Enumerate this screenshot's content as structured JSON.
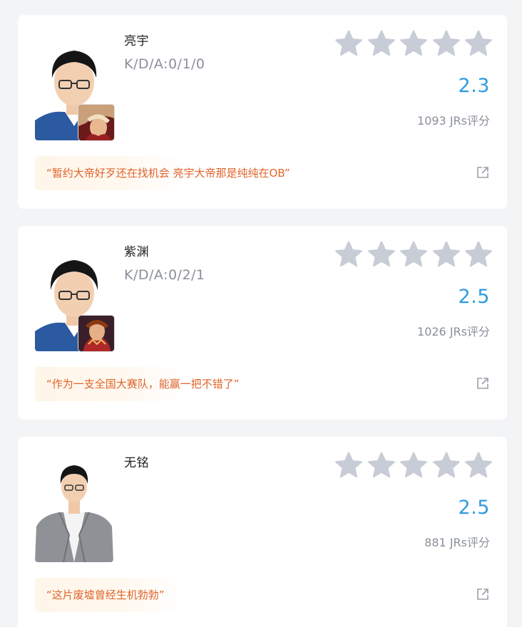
{
  "players": [
    {
      "name": "亮宇",
      "kda": "K/D/A:0/1/0",
      "rating": "2.3",
      "count": "1093 JRs评分",
      "quote": "“暂约大帝好歹还在找机会 亮宇大帝那是纯纯在OB”"
    },
    {
      "name": "紫渊",
      "kda": "K/D/A:0/2/1",
      "rating": "2.5",
      "count": "1026 JRs评分",
      "quote": "“作为一支全国大赛队，能赢一把不错了”"
    },
    {
      "name": "无铭",
      "kda": "",
      "rating": "2.5",
      "count": "881 JRs评分",
      "quote": "“这片废墟曾经生机勃勃”"
    }
  ],
  "colors": {
    "accent": "#2f9be0",
    "quote": "#e0632a",
    "star_empty": "#c8ccd6",
    "muted": "#8a8f99"
  },
  "icons": {
    "star": "star-icon",
    "share": "share-icon"
  }
}
